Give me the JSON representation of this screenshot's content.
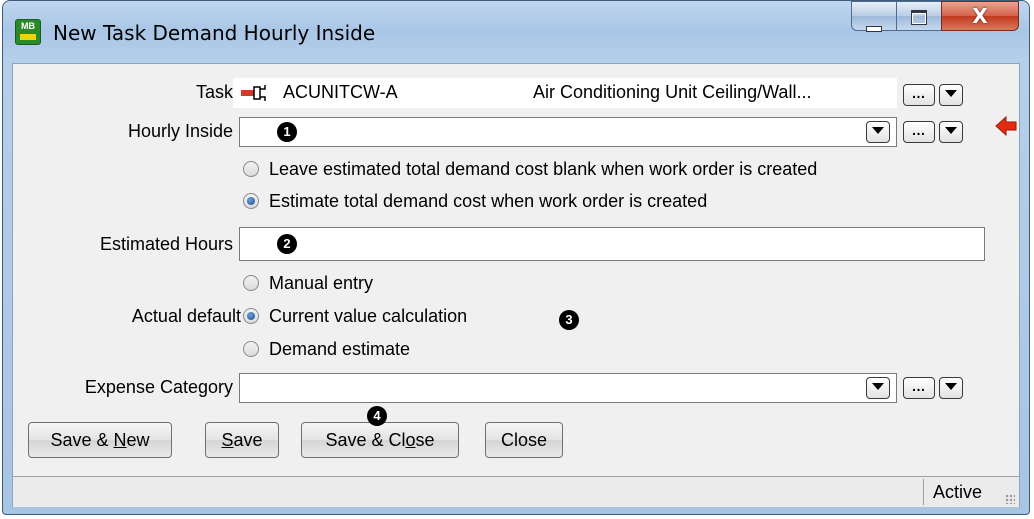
{
  "window": {
    "title": "New Task Demand Hourly Inside",
    "icon_label": "MB",
    "controls": [
      "minimize-icon",
      "maximize-icon",
      "close-icon"
    ],
    "close_glyph": "X"
  },
  "task": {
    "label": "Task",
    "code": "ACUNITCW-A",
    "description": "Air Conditioning Unit Ceiling/Wall...",
    "browse": "…"
  },
  "hourly_inside": {
    "label": "Hourly Inside",
    "value": "",
    "callout": "1",
    "browse": "…"
  },
  "cost_options": {
    "options": [
      {
        "label": "Leave estimated total demand cost blank when work order is created",
        "selected": false
      },
      {
        "label": "Estimate total demand cost when work order is created",
        "selected": true
      }
    ]
  },
  "estimated_hours": {
    "label": "Estimated Hours",
    "value": "",
    "callout": "2"
  },
  "actual_default": {
    "label": "Actual default",
    "callout": "3",
    "options": [
      {
        "label": "Manual entry",
        "selected": false
      },
      {
        "label": "Current value calculation",
        "selected": true
      },
      {
        "label": "Demand estimate",
        "selected": false
      }
    ]
  },
  "expense_category": {
    "label": "Expense Category",
    "value": "",
    "browse": "…"
  },
  "buttons": {
    "save_new": {
      "pre": "Save & ",
      "accel": "N",
      "post": "ew"
    },
    "save": {
      "pre": "",
      "accel": "S",
      "post": "ave"
    },
    "save_close": {
      "pre": "Save & Cl",
      "accel": "o",
      "post": "se"
    },
    "close": "Close",
    "callout": "4"
  },
  "status": {
    "text": "Active"
  },
  "colors": {
    "arrow": "#e32b12",
    "title_bar": "#b6cfe9",
    "radio_selected": "#1b4f95"
  }
}
